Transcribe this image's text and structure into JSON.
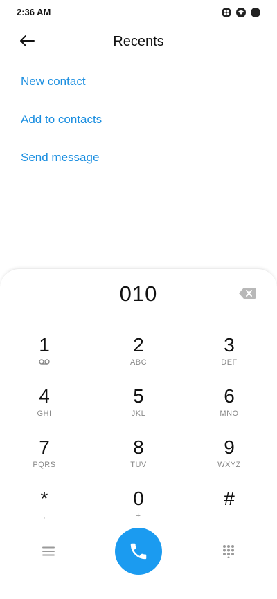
{
  "status_bar": {
    "time": "2:36 AM"
  },
  "header": {
    "title": "Recents",
    "back_icon": "arrow-left-icon"
  },
  "actions": [
    {
      "label": "New contact"
    },
    {
      "label": "Add to contacts"
    },
    {
      "label": "Send message"
    }
  ],
  "dialpad": {
    "number": "010",
    "keys": [
      {
        "digit": "1",
        "letters": ""
      },
      {
        "digit": "2",
        "letters": "ABC"
      },
      {
        "digit": "3",
        "letters": "DEF"
      },
      {
        "digit": "4",
        "letters": "GHI"
      },
      {
        "digit": "5",
        "letters": "JKL"
      },
      {
        "digit": "6",
        "letters": "MNO"
      },
      {
        "digit": "7",
        "letters": "PQRS"
      },
      {
        "digit": "8",
        "letters": "TUV"
      },
      {
        "digit": "9",
        "letters": "WXYZ"
      },
      {
        "digit": "*",
        "letters": ","
      },
      {
        "digit": "0",
        "letters": "+"
      },
      {
        "digit": "#",
        "letters": ""
      }
    ]
  },
  "colors": {
    "accent": "#1a8ee0",
    "call_button": "#1b9bf0"
  }
}
